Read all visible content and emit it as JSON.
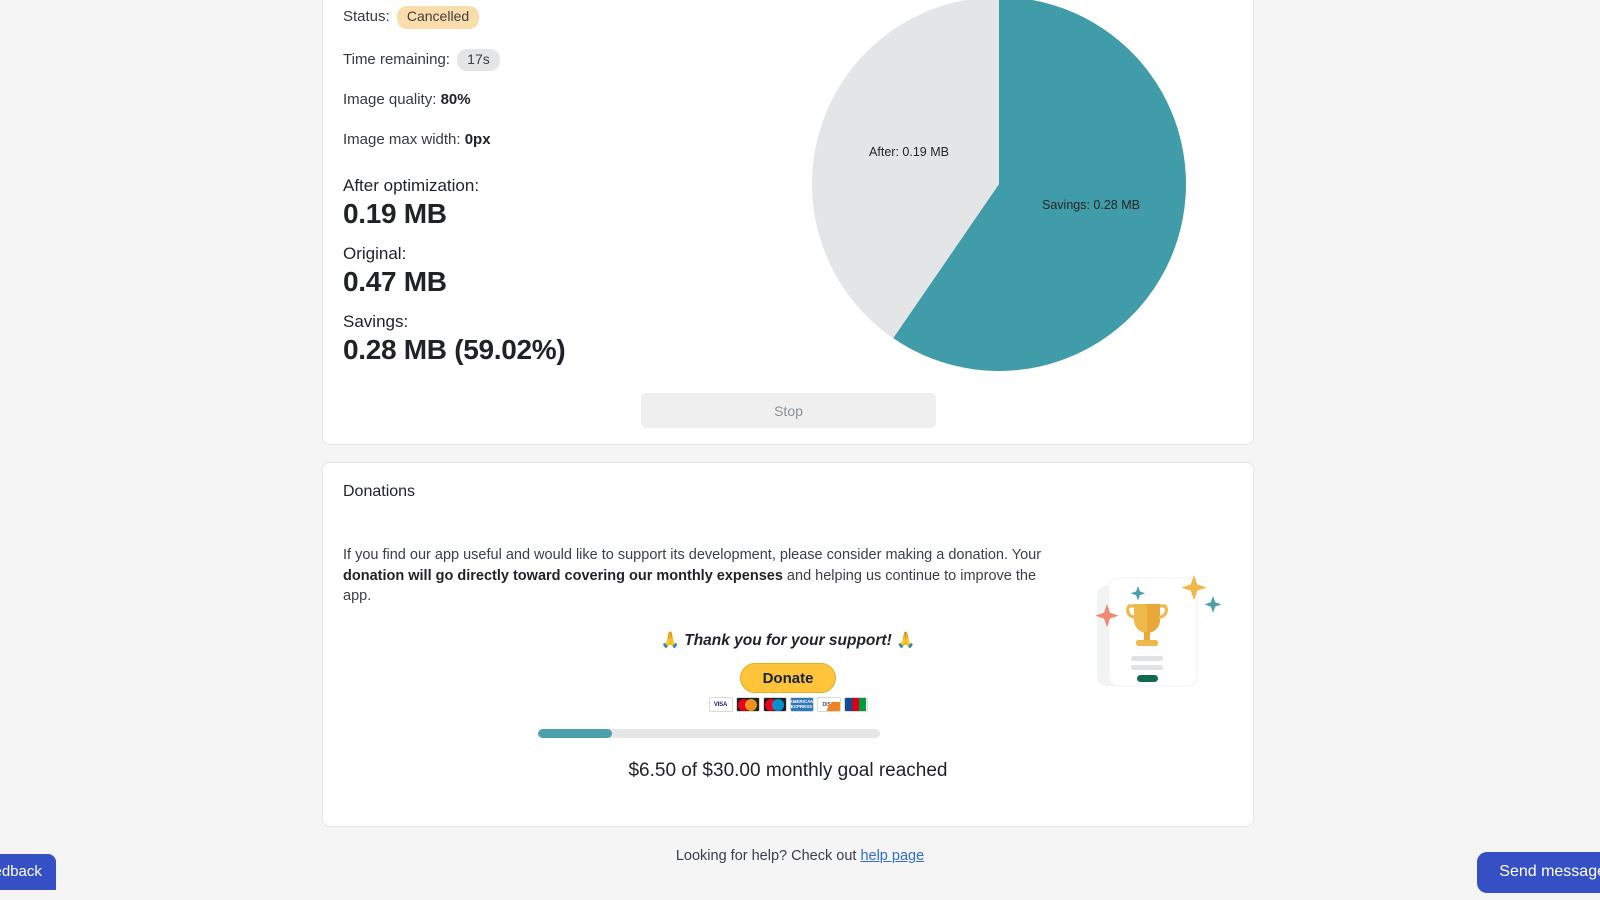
{
  "results": {
    "status_label": "Status:",
    "status_value": "Cancelled",
    "time_label": "Time remaining:",
    "time_value": "17s",
    "quality_label": "Image quality:",
    "quality_value": "80%",
    "max_width_label": "Image max width:",
    "max_width_value": "0px",
    "after_label": "After optimization:",
    "after_value": "0.19 MB",
    "original_label": "Original:",
    "original_value": "0.47 MB",
    "savings_label": "Savings:",
    "savings_value": "0.28 MB (59.02%)",
    "stop_button": "Stop"
  },
  "chart_data": {
    "type": "pie",
    "title": "",
    "categories": [
      "Savings",
      "After"
    ],
    "values": [
      0.28,
      0.19
    ],
    "unit": "MB",
    "labels": [
      "Savings: 0.28 MB",
      "After: 0.19 MB"
    ],
    "colors": [
      "#409ca8",
      "#e4e5e7"
    ],
    "percentages": [
      59.02,
      40.98
    ],
    "legend": "none",
    "start_angle_deg": 0,
    "direction": "clockwise"
  },
  "donations": {
    "title": "Donations",
    "intro_1": "If you find our app useful and would like to support its development, please consider making a donation. Your ",
    "intro_bold": "donation will go directly toward covering our monthly expenses",
    "intro_2": " and helping us continue to improve the app.",
    "thanks_emoji_left": "🙏",
    "thanks_text": "Thank you for your support!",
    "thanks_emoji_right": "🙏",
    "donate_button": "Donate",
    "payment_methods": [
      "VISA",
      "Mastercard",
      "Maestro",
      "AMERICAN EXPRESS",
      "DISCOVER",
      "JCB"
    ],
    "progress_percent": 21.7,
    "goal_text": "$6.50 of $30.00 monthly goal reached",
    "raised": "$6.50",
    "goal": "$30.00"
  },
  "footer": {
    "help_prefix": "Looking for help? Check out ",
    "help_link": "help page"
  },
  "widgets": {
    "feedback_label": "Feedback",
    "send_message_label": "Send message"
  },
  "colors": {
    "accent_teal": "#409ca8",
    "brand_blue": "#3550c4",
    "donate_yellow": "#ffc439",
    "badge_cancelled": "#fbdcab"
  }
}
